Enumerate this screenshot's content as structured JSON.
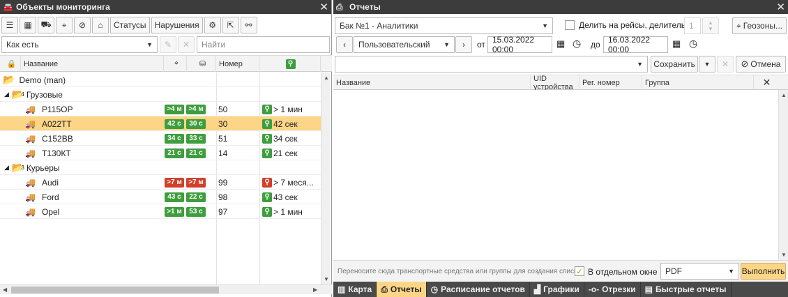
{
  "left_panel": {
    "title": "Объекты мониторинга",
    "toolbar": {
      "statuses_label": "Статусы",
      "violations_label": "Нарушения"
    },
    "filter_select": "Как есть",
    "search_placeholder": "Найти",
    "columns": {
      "name": "Название",
      "number": "Номер"
    },
    "root_group": "Demo (man)",
    "groups": [
      {
        "name": "Грузовые",
        "count": "4",
        "items": [
          {
            "name": "Р115ОР",
            "b1": ">4 м",
            "b2": ">4 м",
            "c1": "green",
            "c2": "green",
            "number": "50",
            "status": "> 1 мин",
            "moto": "green",
            "selected": false
          },
          {
            "name": "А022ТТ",
            "b1": "42 с",
            "b2": "30 с",
            "c1": "green",
            "c2": "green",
            "number": "30",
            "status": "42 сек",
            "moto": "green",
            "selected": true
          },
          {
            "name": "С152ВВ",
            "b1": "34 с",
            "b2": "33 с",
            "c1": "green",
            "c2": "green",
            "number": "51",
            "status": "34 сек",
            "moto": "green",
            "selected": false
          },
          {
            "name": "Т130КТ",
            "b1": "21 с",
            "b2": "21 с",
            "c1": "green",
            "c2": "green",
            "number": "14",
            "status": "21 сек",
            "moto": "green",
            "selected": false
          }
        ]
      },
      {
        "name": "Курьеры",
        "count": "3",
        "items": [
          {
            "name": "Audi",
            "b1": ">7 м",
            "b2": ">7 м",
            "c1": "red",
            "c2": "red",
            "number": "99",
            "status": "> 7 меся...",
            "moto": "red",
            "selected": false
          },
          {
            "name": "Ford",
            "b1": "43 с",
            "b2": "22 с",
            "c1": "green",
            "c2": "green",
            "number": "98",
            "status": "43 сек",
            "moto": "green",
            "selected": false
          },
          {
            "name": "Opel",
            "b1": ">1 м",
            "b2": "53 с",
            "c1": "green",
            "c2": "green",
            "number": "97",
            "status": "> 1 мин",
            "moto": "green",
            "selected": false
          }
        ]
      }
    ]
  },
  "right_panel": {
    "title": "Отчеты",
    "template_select": "Бак №1 - Аналитики",
    "split_label": "Делить на рейсы, делитель №",
    "split_value": "1",
    "geozones_label": "Геозоны...",
    "period_select": "Пользовательский",
    "from_label": "от",
    "from_value": "15.03.2022 00:00",
    "to_label": "до",
    "to_value": "16.03.2022 00:00",
    "save_label": "Сохранить",
    "cancel_label": "Отмена",
    "columns": {
      "name": "Название",
      "uid": "UID устройства",
      "reg": "Рег. номер",
      "group": "Группа"
    },
    "drop_hint": "Переносите сюда транспортные средства или группы для создания списка",
    "separate_window_label": "В отдельном окне",
    "format_select": "PDF",
    "execute_label": "Выполнить"
  },
  "bottom_tabs": [
    {
      "label": "Карта",
      "icon": "map-icon"
    },
    {
      "label": "Отчеты",
      "icon": "printer-icon"
    },
    {
      "label": "Расписание отчетов",
      "icon": "clock-icon"
    },
    {
      "label": "Графики",
      "icon": "bar-chart-icon"
    },
    {
      "label": "Отрезки",
      "icon": "segment-icon"
    },
    {
      "label": "Быстрые отчеты",
      "icon": "document-icon"
    }
  ]
}
